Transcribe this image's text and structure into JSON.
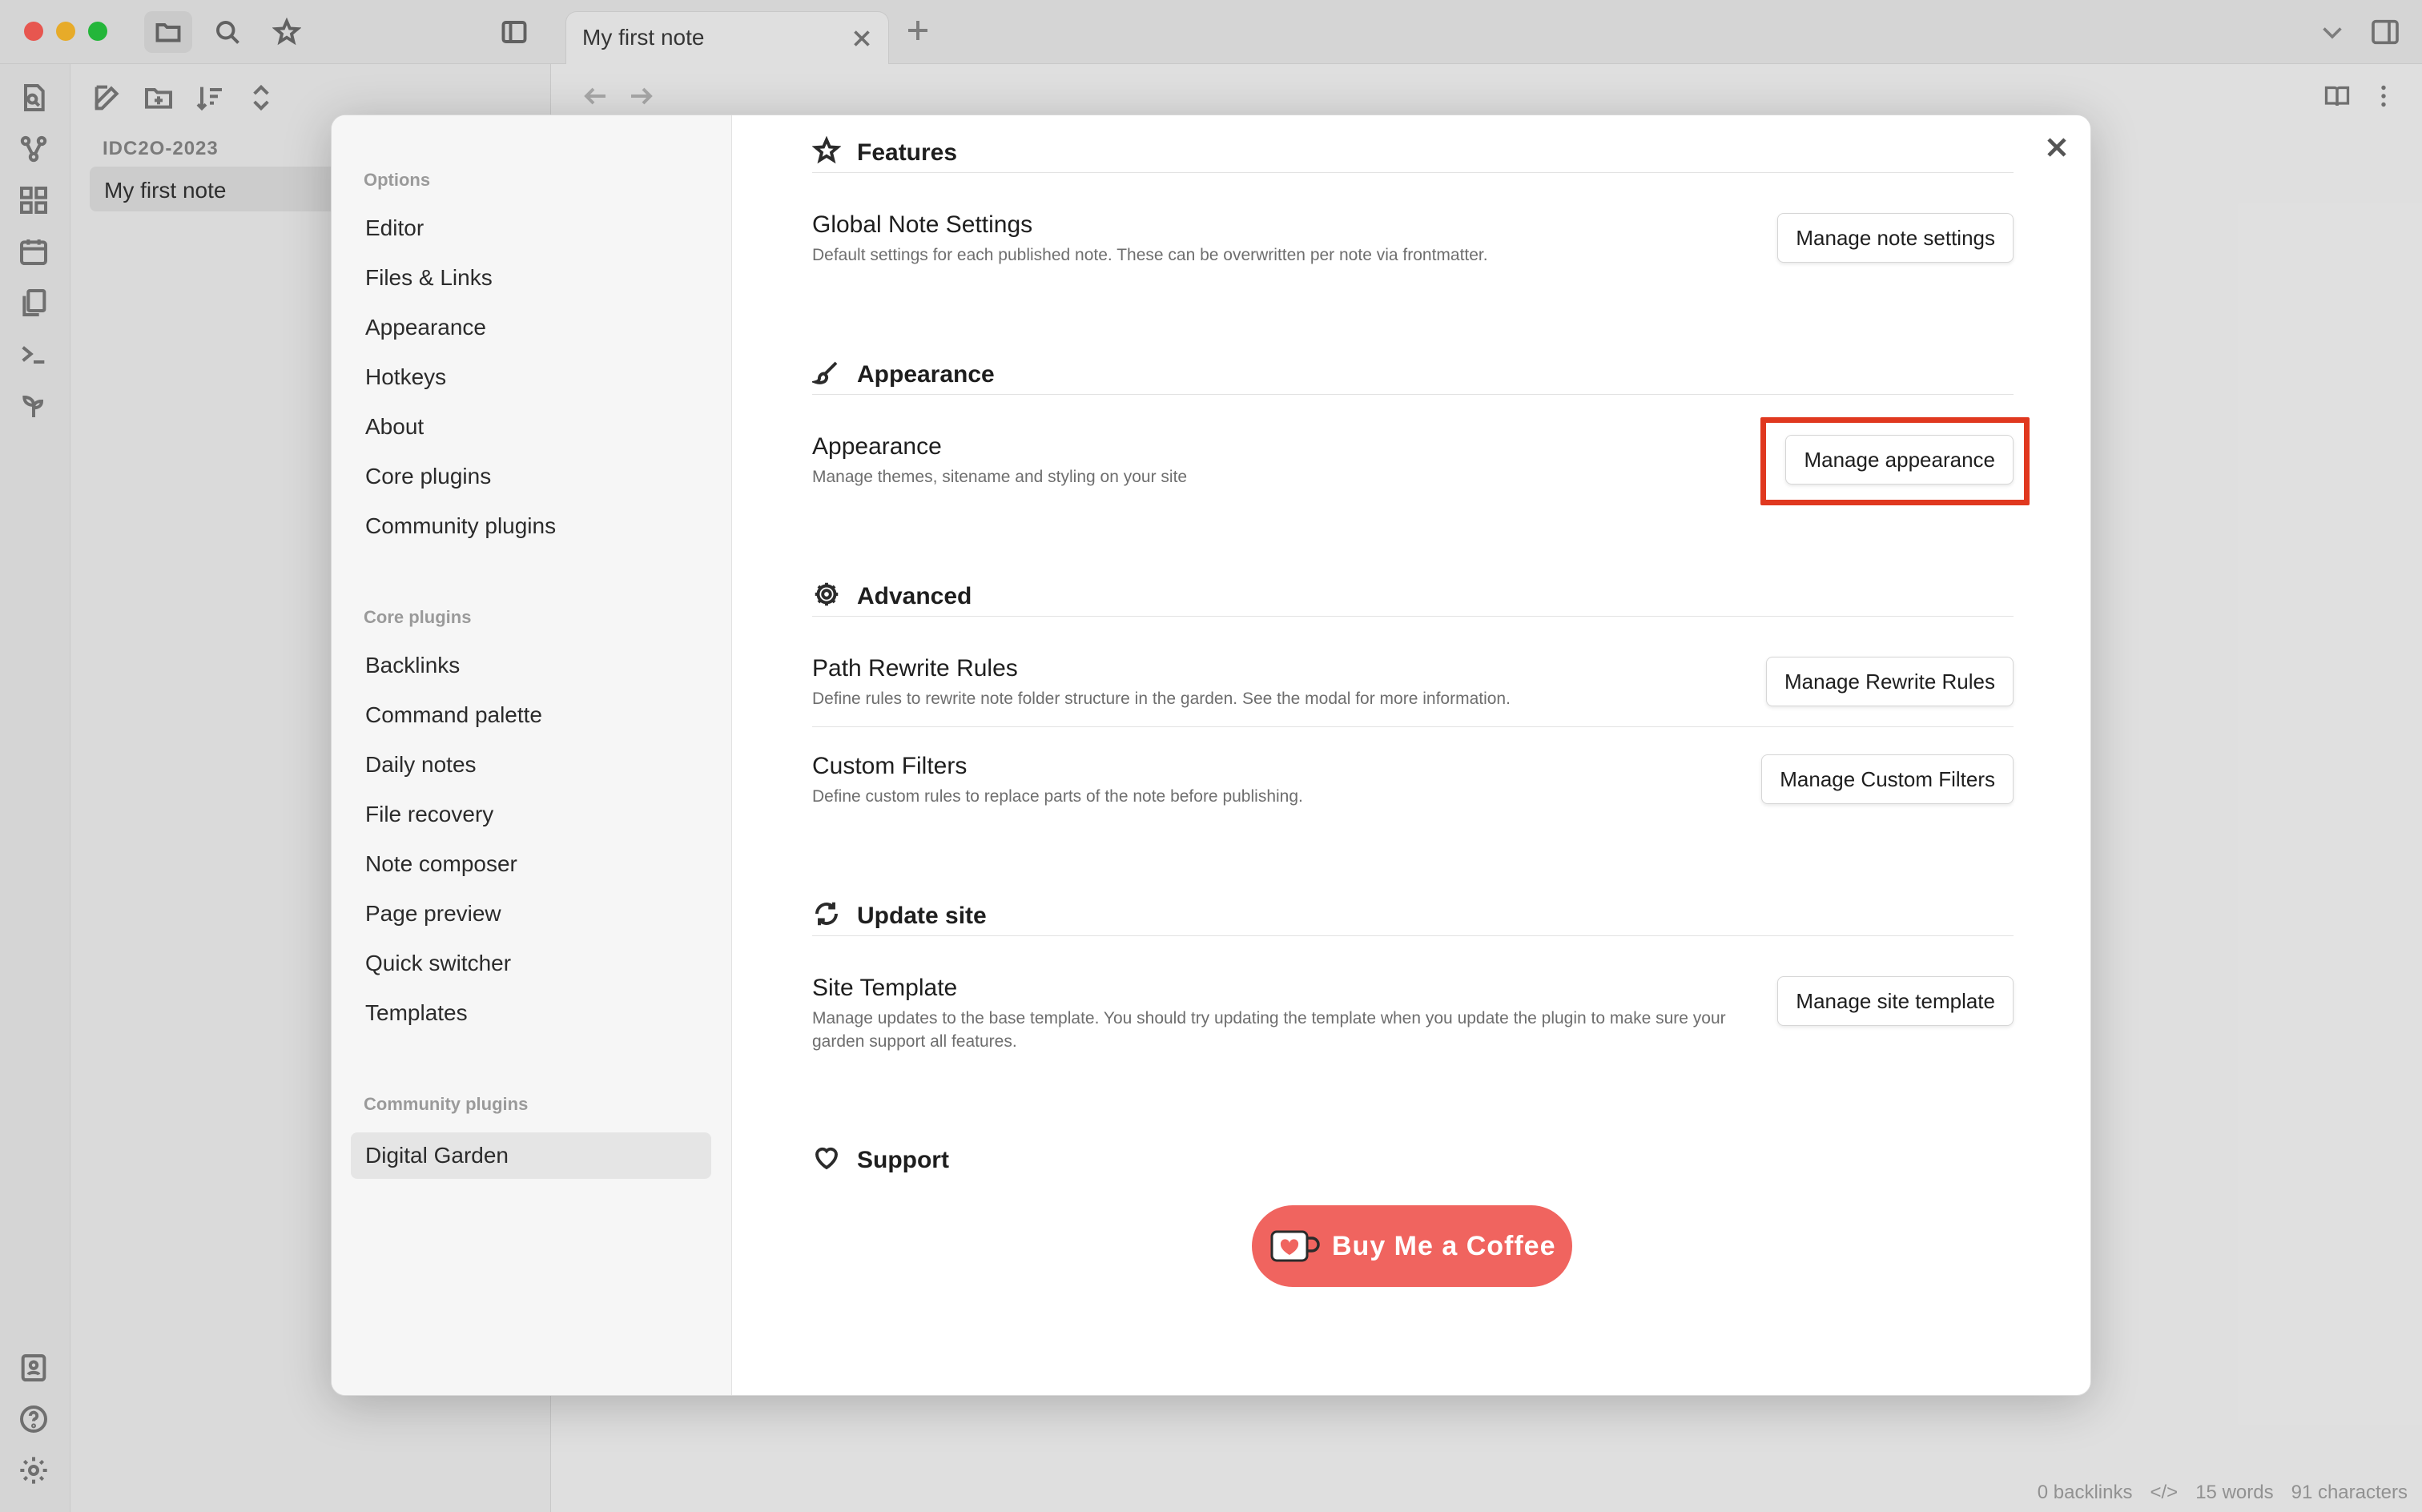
{
  "tab": {
    "title": "My first note"
  },
  "explorer": {
    "vault_name": "IDC2O-2023",
    "files": [
      "My first note"
    ]
  },
  "status_bar": {
    "backlinks": "0 backlinks",
    "code_icon": "</>",
    "words": "15 words",
    "characters": "91 characters"
  },
  "settings_nav": {
    "options_title": "Options",
    "options": [
      "Editor",
      "Files & Links",
      "Appearance",
      "Hotkeys",
      "About",
      "Core plugins",
      "Community plugins"
    ],
    "core_title": "Core plugins",
    "core": [
      "Backlinks",
      "Command palette",
      "Daily notes",
      "File recovery",
      "Note composer",
      "Page preview",
      "Quick switcher",
      "Templates"
    ],
    "community_title": "Community plugins",
    "community": [
      "Digital Garden"
    ]
  },
  "sections": {
    "features": {
      "title": "Features",
      "global_note": {
        "name": "Global Note Settings",
        "desc": "Default settings for each published note. These can be overwritten per note via frontmatter.",
        "button": "Manage note settings"
      }
    },
    "appearance": {
      "title": "Appearance",
      "item": {
        "name": "Appearance",
        "desc": "Manage themes, sitename and styling on your site",
        "button": "Manage appearance"
      }
    },
    "advanced": {
      "title": "Advanced",
      "path_rewrite": {
        "name": "Path Rewrite Rules",
        "desc": "Define rules to rewrite note folder structure in the garden. See the modal for more information.",
        "button": "Manage Rewrite Rules"
      },
      "custom_filters": {
        "name": "Custom Filters",
        "desc": "Define custom rules to replace parts of the note before publishing.",
        "button": "Manage Custom Filters"
      }
    },
    "update_site": {
      "title": "Update site",
      "site_template": {
        "name": "Site Template",
        "desc": "Manage updates to the base template. You should try updating the template when you update the plugin to make sure your garden support all features.",
        "button": "Manage site template"
      }
    },
    "support": {
      "title": "Support",
      "coffee_label": "Buy Me a Coffee"
    }
  },
  "colors": {
    "highlight": "#e0381f",
    "coffee": "#f0645f",
    "active_nav": "#e5e5e5"
  }
}
